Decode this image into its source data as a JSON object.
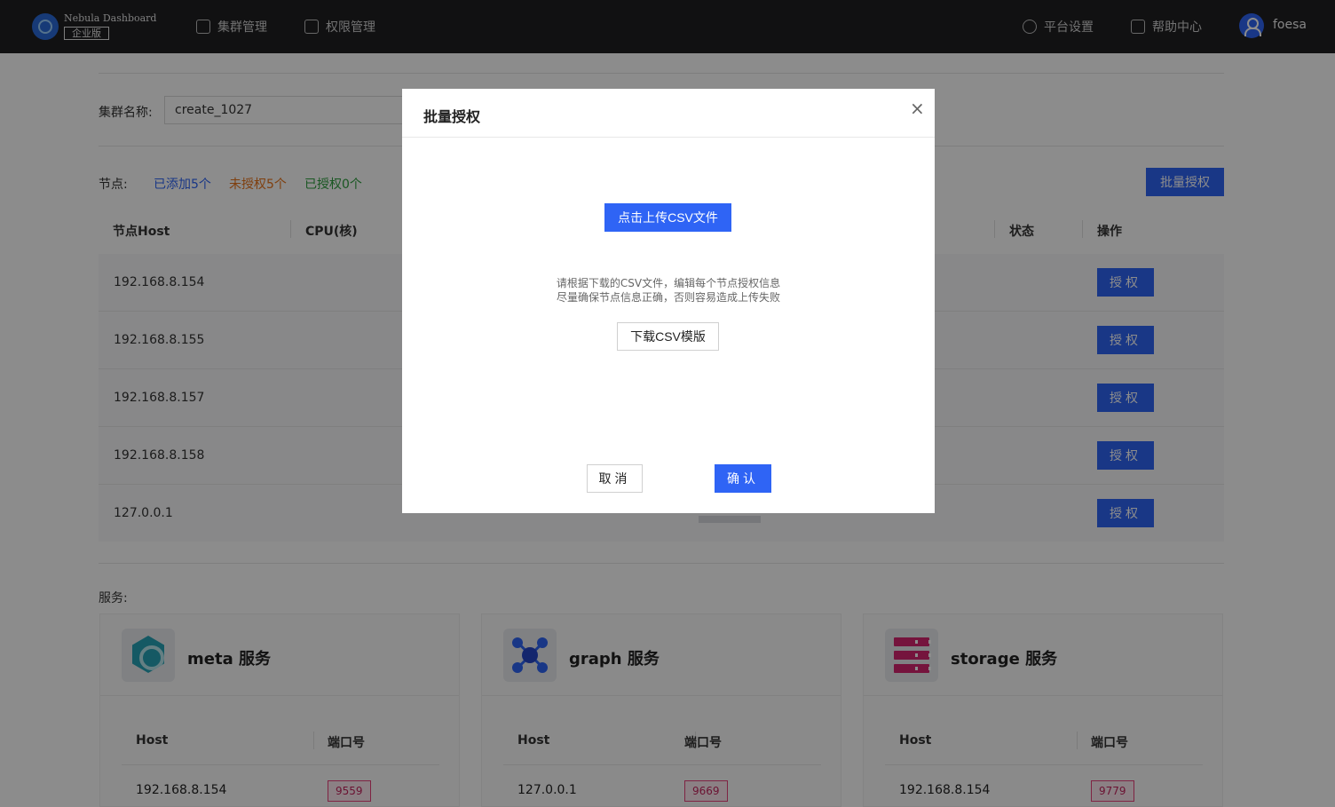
{
  "topbar": {
    "app_name": "Nebula Dashboard",
    "edition_badge": "企业版",
    "nav": [
      "集群管理",
      "权限管理"
    ],
    "right_nav": [
      "平台设置",
      "帮助中心"
    ],
    "user_name": "foesa"
  },
  "cluster": {
    "name_label": "集群名称:",
    "name_value": "create_1027"
  },
  "nodes": {
    "label": "节点:",
    "added": "已添加5个",
    "unauthorized": "未授权5个",
    "authorized": "已授权0个",
    "batch_button": "批量授权",
    "columns": [
      "节点Host",
      "CPU(核)",
      "状态",
      "操作"
    ],
    "rows": [
      {
        "host": "192.168.8.154",
        "action": "授权"
      },
      {
        "host": "192.168.8.155",
        "action": "授权"
      },
      {
        "host": "192.168.8.157",
        "action": "授权"
      },
      {
        "host": "192.168.8.158",
        "action": "授权"
      },
      {
        "host": "127.0.0.1",
        "action": "授权"
      }
    ]
  },
  "services": {
    "label": "服务:",
    "cards": [
      {
        "title": "meta 服务",
        "host_header": "Host",
        "port_header": "端口号",
        "host": "192.168.8.154",
        "port": "9559"
      },
      {
        "title": "graph 服务",
        "host_header": "Host",
        "port_header": "端口号",
        "host": "127.0.0.1",
        "port": "9669"
      },
      {
        "title": "storage 服务",
        "host_header": "Host",
        "port_header": "端口号",
        "host": "192.168.8.154",
        "port": "9779"
      }
    ]
  },
  "modal": {
    "title": "批量授权",
    "close_glyph": "×",
    "upload_button": "点击上传CSV文件",
    "tip_line1": "请根据下载的CSV文件，编辑每个节点授权信息",
    "tip_line2": "尽量确保节点信息正确，否则容易造成上传失败",
    "download_button": "下载CSV模版",
    "cancel_button": "取消",
    "confirm_button": "确认"
  },
  "colors": {
    "primary": "#2f64f5",
    "added": "#2f64f5",
    "unauthorized": "#e8731a",
    "authorized": "#2e9e3e",
    "port_tag": "#e8407a"
  }
}
